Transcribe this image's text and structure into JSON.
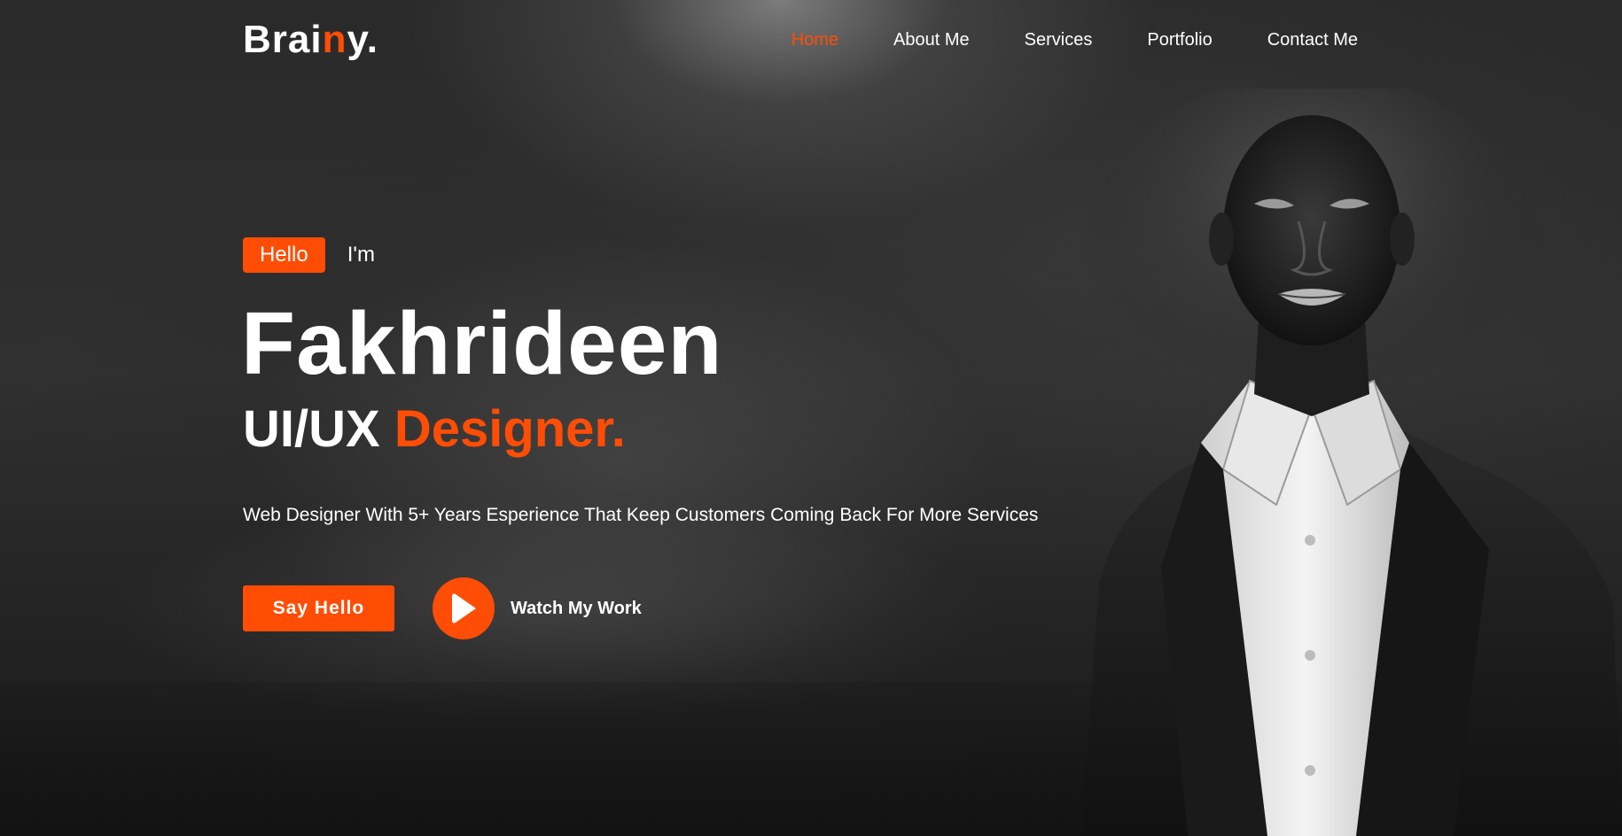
{
  "brand": {
    "prefix": "Brai",
    "accent_letter": "n",
    "suffix": "y."
  },
  "nav": {
    "items": [
      {
        "label": "Home",
        "active": true
      },
      {
        "label": "About Me",
        "active": false
      },
      {
        "label": "Services",
        "active": false
      },
      {
        "label": "Portfolio",
        "active": false
      },
      {
        "label": "Contact Me",
        "active": false
      }
    ]
  },
  "hero": {
    "hello_badge": "Hello",
    "im": "I'm",
    "name": "Fakhrideen",
    "role_plain": "UI/UX",
    "role_accent": "Designer.",
    "tagline": "Web Designer With 5+ Years Esperience That Keep Customers Coming Back For More Services",
    "primary_button": "Say Hello",
    "secondary_button": "Watch My Work"
  },
  "icons": {
    "play": "play-icon"
  },
  "colors": {
    "accent": "#ff4d05",
    "background": "#2a2a2a",
    "text": "#ffffff"
  }
}
